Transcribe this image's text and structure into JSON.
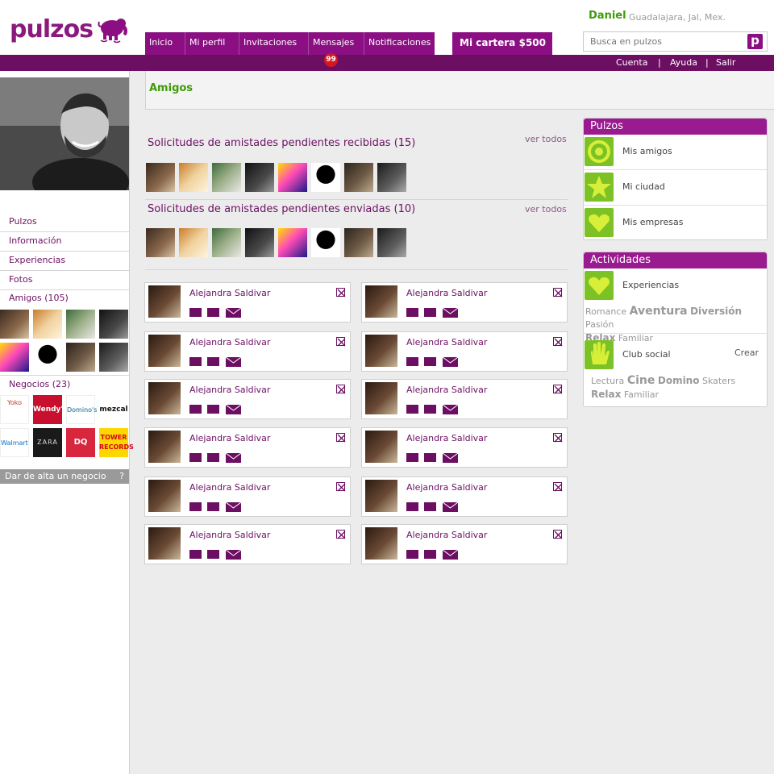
{
  "brand": {
    "name": "pulzos",
    "color": "#8b0f83",
    "green": "#3f9a0b"
  },
  "nav": {
    "items": [
      "Inicio",
      "Mi perfil",
      "Invitaciones",
      "Mensajes",
      "Notificaciones"
    ],
    "badge": "99"
  },
  "wallet": {
    "label": "Mi cartera",
    "amount": "$500"
  },
  "user": {
    "name": "Daniel",
    "city": "Guadalajara, Jal, Mex."
  },
  "search": {
    "placeholder": "Busca en pulzos",
    "button_letter": "p"
  },
  "subbar": {
    "items": [
      "Cuenta",
      "Ayuda",
      "Salir"
    ],
    "separator": "|"
  },
  "left": {
    "nav": [
      "Pulzos",
      "Información",
      "Experiencias",
      "Fotos",
      "Amigos (105)",
      "Negocios (23)"
    ],
    "add_business": "Dar de alta un negocio",
    "add_business_help": "?",
    "business_logos": [
      "Yoko",
      "Wendy's",
      "Domino's",
      "mezcal",
      "Walmart",
      "ZARA",
      "DQ",
      "TOWER RECORDS"
    ]
  },
  "main": {
    "title": "Amigos",
    "received": {
      "title": "Solicitudes de amistades pendientes recibidas (15)",
      "link": "ver todos"
    },
    "sent": {
      "title": "Solicitudes de amistades pendientes enviadas (10)",
      "link": "ver todos"
    },
    "friends": [
      "Alejandra Saldivar",
      "Alejandra Saldivar",
      "Alejandra Saldivar",
      "Alejandra Saldivar",
      "Alejandra Saldivar",
      "Alejandra Saldivar",
      "Alejandra Saldivar",
      "Alejandra Saldivar",
      "Alejandra Saldivar",
      "Alejandra Saldivar",
      "Alejandra Saldivar",
      "Alejandra Saldivar"
    ]
  },
  "right": {
    "pulzos": {
      "title": "Pulzos",
      "items": [
        "Mis amigos",
        "Mi ciudad",
        "Mis empresas"
      ]
    },
    "actividades": {
      "title": "Actividades",
      "experiencias": "Experiencias",
      "exp_tags": [
        "Romance",
        "Aventura",
        "Diversión",
        "Pasión",
        "Relax",
        "Familiar"
      ],
      "club": "Club social",
      "crear": "Crear",
      "club_tags": [
        "Lectura",
        "Cine",
        "Domino",
        "Skaters",
        "Relax",
        "Familiar"
      ]
    }
  }
}
